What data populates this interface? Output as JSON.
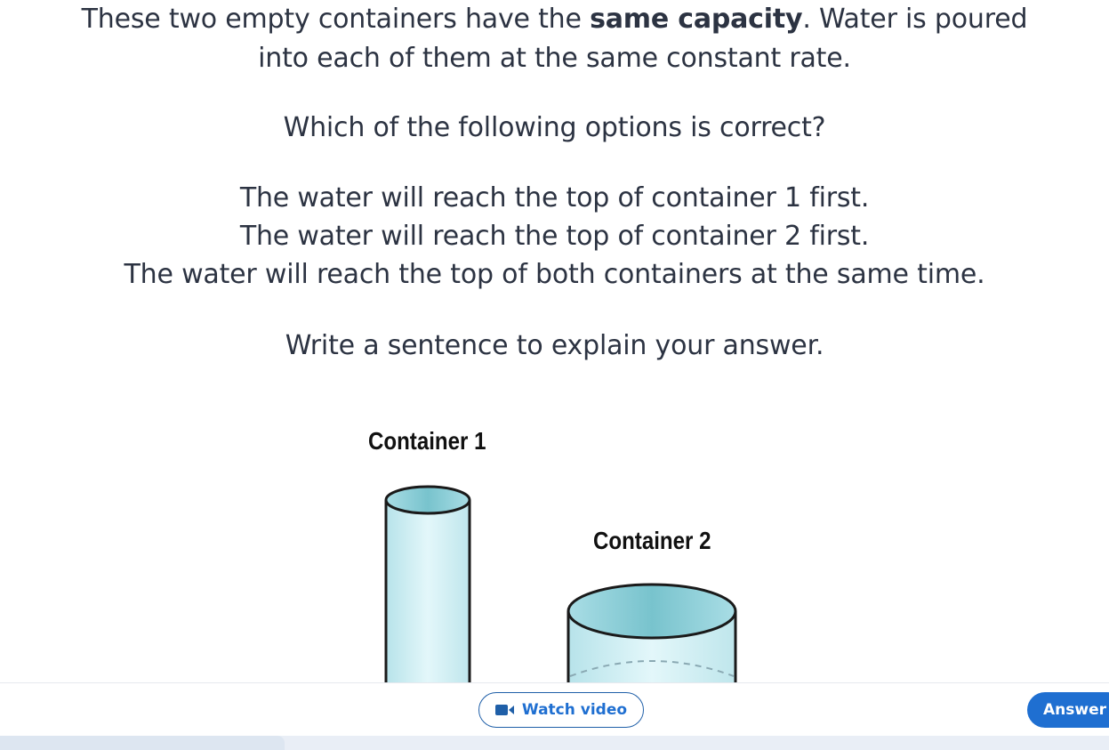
{
  "question": {
    "intro_part1": "These two empty containers have the ",
    "intro_bold": "same capacity",
    "intro_part2": ". Water is poured",
    "intro_line2": "into each of them at the same constant rate.",
    "ask": "Which of the following options is correct?",
    "options": [
      "The water will reach the top of container 1 first.",
      "The water will reach the top of container 2 first.",
      "The water will reach the top of both containers at the same time."
    ],
    "write": "Write a sentence to explain your answer."
  },
  "figure": {
    "container1_label": "Container 1",
    "container2_label": "Container 2",
    "water_color": "#cfeef3",
    "water_top_color": "#7cc7d1",
    "outline_color": "#1a1a1a"
  },
  "toolbar": {
    "watch_video_label": "Watch video",
    "watch_video_icon": "video-camera-icon",
    "answer_label": "Answer",
    "accent_color": "#1f6fd1"
  }
}
